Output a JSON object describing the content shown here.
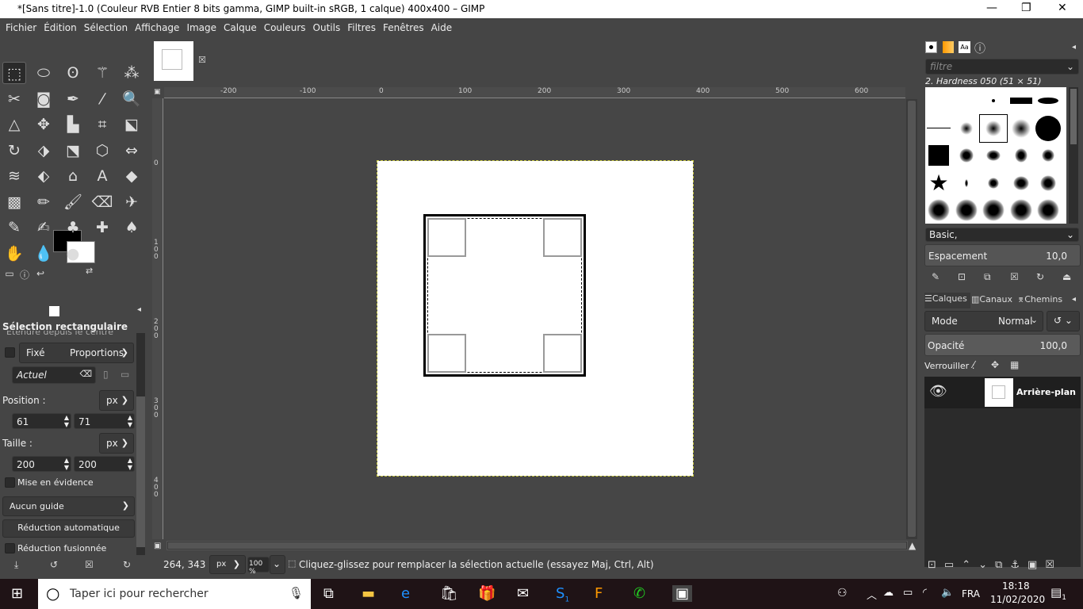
{
  "window": {
    "title": "*[Sans titre]-1.0 (Couleur RVB Entier 8 bits gamma, GIMP built-in sRGB, 1 calque) 400x400 – GIMP",
    "minimize": "—",
    "maximize": "❐",
    "close": "✕"
  },
  "menu": [
    "Fichier",
    "Édition",
    "Sélection",
    "Affichage",
    "Image",
    "Calque",
    "Couleurs",
    "Outils",
    "Filtres",
    "Fenêtres",
    "Aide"
  ],
  "toolbox": {
    "tools": [
      "rect-select",
      "ellipse-select",
      "free-select",
      "fuzzy-select",
      "select-by-color",
      "scissors",
      "foreground-select",
      "paths",
      "color-picker",
      "zoom",
      "measure",
      "move",
      "align",
      "crop",
      "unified-transform",
      "rotate",
      "shear",
      "perspective",
      "3d-transform",
      "flip",
      "warp",
      "handle-transform",
      "cage",
      "text",
      "bucket-fill",
      "gradient",
      "pencil",
      "paintbrush",
      "eraser",
      "airbrush",
      "ink",
      "mypaint",
      "clone",
      "heal",
      "perspective-clone",
      "smudge",
      "blur",
      "dodge-burn"
    ],
    "fg_color": "#000000",
    "bg_color": "#ffffff"
  },
  "tool_options": {
    "title": "Sélection rectangulaire",
    "partial_option": "Étendre depuis le centre",
    "fixed_label": "Fixé",
    "fixed_mode": "Proportions",
    "ratio_value": "Actuel",
    "position_label": "Position :",
    "position_unit": "px",
    "pos_x": "61",
    "pos_y": "71",
    "size_label": "Taille :",
    "size_unit": "px",
    "width": "200",
    "height": "200",
    "highlight": "Mise en évidence",
    "guides": "Aucun guide",
    "auto_shrink": "Réduction automatique",
    "shrink_merged": "Réduction fusionnée"
  },
  "rulers": {
    "top": [
      "-200",
      "-100",
      "0",
      "100",
      "200",
      "300",
      "400",
      "500",
      "600"
    ],
    "left": [
      "0",
      "100",
      "200",
      "300",
      "400"
    ]
  },
  "status": {
    "coords": "264, 343",
    "unit": "px",
    "zoom": "100 %",
    "message": "Cliquez-glissez pour remplacer la sélection actuelle (essayez Maj, Ctrl, Alt)"
  },
  "brushes": {
    "filter_placeholder": "filtre",
    "selected": "2. Hardness 050 (51 × 51)",
    "tag": "Basic,",
    "spacing_label": "Espacement",
    "spacing_value": "10,0"
  },
  "layers": {
    "tabs": [
      "Calques",
      "Canaux",
      "Chemins"
    ],
    "mode_label": "Mode",
    "mode_value": "Normal",
    "opacity_label": "Opacité",
    "opacity_value": "100,0",
    "lock_label": "Verrouiller :",
    "items": [
      {
        "name": "Arrière-plan",
        "visible": true
      }
    ]
  },
  "taskbar": {
    "search_placeholder": "Taper ici pour rechercher",
    "lang": "FRA",
    "time": "18:18",
    "date": "11/02/2020",
    "notif_count": "1",
    "skype_badge": "1"
  }
}
